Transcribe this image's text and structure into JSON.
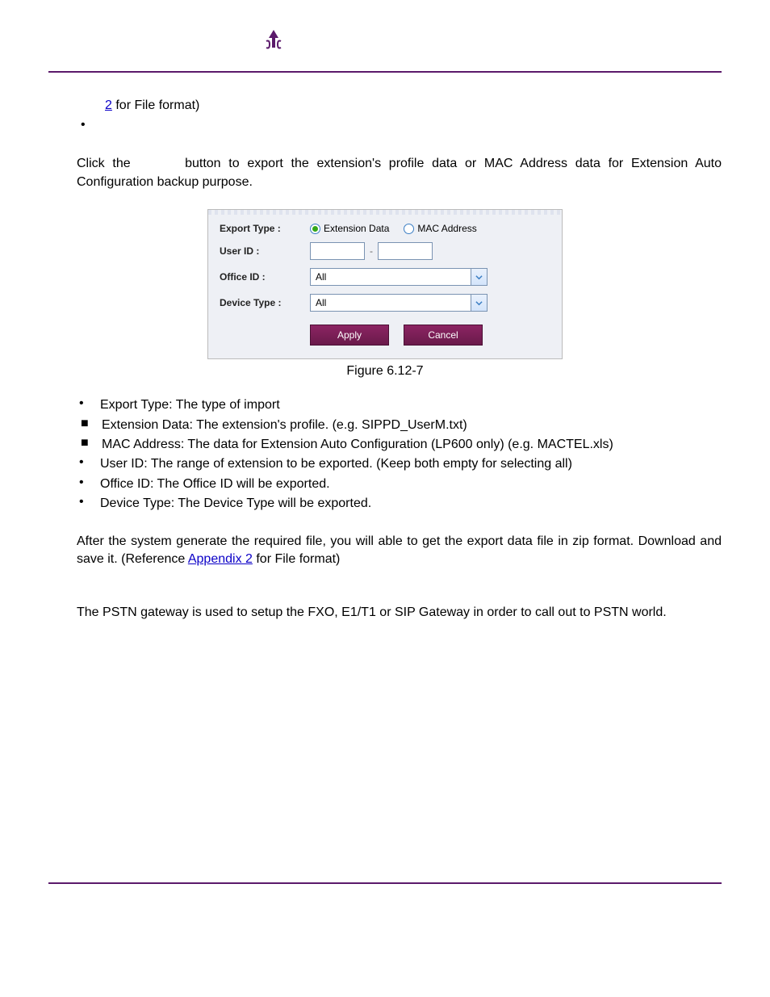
{
  "top": {
    "link_2": "2",
    "link_2_after": " for File format)"
  },
  "intro": {
    "part1": "Click the ",
    "part2": " button to export the extension's profile data or MAC Address data for Extension Auto Configuration backup purpose."
  },
  "form": {
    "exportTypeLabel": "Export Type :",
    "radio1": "Extension Data",
    "radio2": "MAC Address",
    "userIdLabel": "User ID :",
    "userIdFrom": "",
    "userIdTo": "",
    "officeIdLabel": "Office ID :",
    "officeIdValue": "All",
    "deviceTypeLabel": "Device Type :",
    "deviceTypeValue": "All",
    "applyBtn": "Apply",
    "cancelBtn": "Cancel"
  },
  "figureCaption": "Figure 6.12-7",
  "bullets": {
    "b1": "Export Type: The type of import",
    "b1a": "Extension Data: The extension's profile. (e.g. SIPPD_UserM.txt)",
    "b1b": "MAC Address: The data for Extension Auto Configuration (LP600 only) (e.g. MACTEL.xls)",
    "b2": "User ID: The range of extension to be exported. (Keep both empty for selecting all)",
    "b3": "Office ID: The Office ID will be exported.",
    "b4": "Device Type: The Device Type will be exported."
  },
  "after": {
    "p1_a": "After the system generate the required file, you will able to get the export data file in zip format. Download and save it. (Reference ",
    "p1_link": "Appendix 2",
    "p1_b": " for File format)"
  },
  "pstn": "The PSTN gateway is used to setup the FXO, E1/T1 or SIP Gateway in order to call out to PSTN world."
}
